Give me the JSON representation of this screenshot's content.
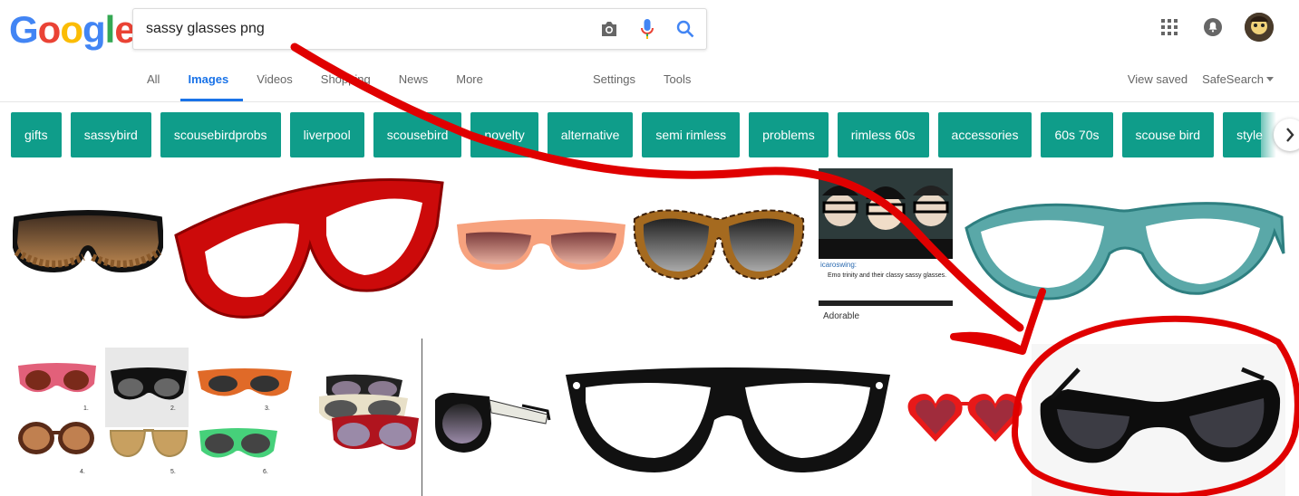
{
  "brand": {
    "logo_letters": [
      "G",
      "o",
      "o",
      "g",
      "l",
      "e"
    ],
    "logo_colors": [
      "#4285F4",
      "#EA4335",
      "#FBBC05",
      "#4285F4",
      "#34A853",
      "#EA4335"
    ]
  },
  "search": {
    "query": "sassy glasses png"
  },
  "tabs": [
    {
      "label": "All"
    },
    {
      "label": "Images"
    },
    {
      "label": "Videos"
    },
    {
      "label": "Shopping"
    },
    {
      "label": "News"
    },
    {
      "label": "More"
    }
  ],
  "tools": {
    "settings": "Settings",
    "tools": "Tools"
  },
  "right_links": {
    "view_saved": "View saved",
    "safesearch": "SafeSearch"
  },
  "chips": [
    "gifts",
    "sassybird",
    "scousebirdprobs",
    "liverpool",
    "scousebird",
    "novelty",
    "alternative",
    "semi rimless",
    "problems",
    "rimless 60s",
    "accessories",
    "60s 70s",
    "scouse bird",
    "style"
  ],
  "results": {
    "photo_username": "icaroswing:",
    "photo_text": "Emo trinity and their classy sassy glasses.",
    "photo_caption": "Adorable",
    "collage_numbers": [
      "1.",
      "2.",
      "3.",
      "4.",
      "5.",
      "6."
    ]
  },
  "colors": {
    "chip": "#0f9d8a",
    "accent": "#1a73e8",
    "annotation": "#e00000"
  },
  "icons": [
    "camera-icon",
    "microphone-icon",
    "search-icon",
    "apps-grid-icon",
    "notifications-icon",
    "chevron-right-icon",
    "chevron-down-icon"
  ]
}
